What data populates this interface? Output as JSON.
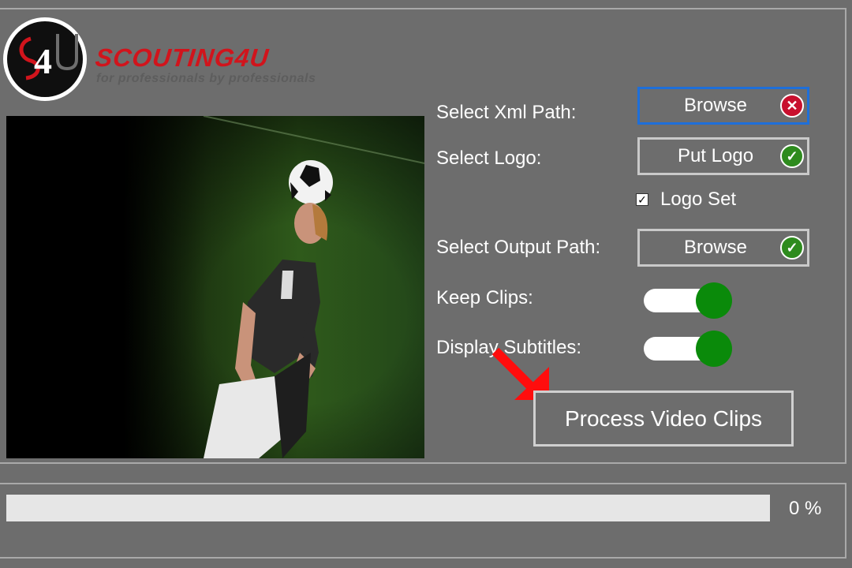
{
  "brand": {
    "name": "SCOUTING4U",
    "tagline": "for professionals by professionals"
  },
  "form": {
    "xml_label": "Select Xml Path:",
    "xml_button": "Browse",
    "xml_status": "error",
    "logo_label": "Select Logo:",
    "logo_button": "Put Logo",
    "logo_status": "ok",
    "logo_set_label": "Logo Set",
    "logo_set_checked": true,
    "output_label": "Select Output Path:",
    "output_button": "Browse",
    "output_status": "ok",
    "keep_clips_label": "Keep Clips:",
    "keep_clips_on": true,
    "display_subtitles_label": "Display Subtitles:",
    "display_subtitles_on": true,
    "process_button": "Process Video Clips"
  },
  "progress": {
    "value": 0,
    "text": "0 %"
  },
  "colors": {
    "background": "#6d6d6d",
    "accent_red": "#d1141c",
    "toggle_green": "#0a8a0a",
    "focus_blue": "#1e6fd9"
  },
  "icons": {
    "xml_status_icon": "error-x-icon",
    "logo_status_icon": "check-icon",
    "output_status_icon": "check-icon",
    "arrow": "red-arrow-icon"
  }
}
